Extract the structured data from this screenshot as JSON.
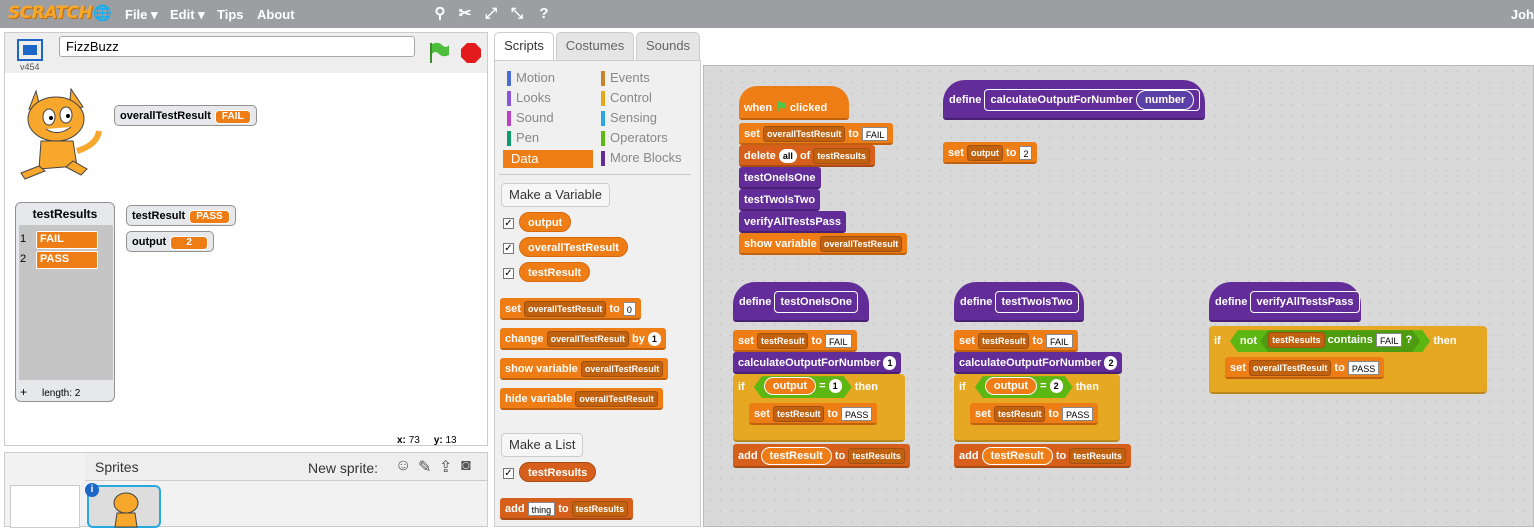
{
  "topbar": {
    "logo": "SCRATCH",
    "menu": [
      "File ▾",
      "Edit ▾",
      "Tips",
      "About"
    ],
    "user": "Joh"
  },
  "stage": {
    "project_name": "FizzBuzz",
    "version": "v454",
    "monitors": {
      "overall_label": "overallTestResult",
      "overall_value": "FAIL",
      "testresult_label": "testResult",
      "testresult_value": "PASS",
      "output_label": "output",
      "output_value": "2"
    },
    "list": {
      "title": "testResults",
      "items": [
        {
          "idx": "1",
          "val": "FAIL"
        },
        {
          "idx": "2",
          "val": "PASS"
        }
      ],
      "add": "+",
      "length": "length: 2"
    },
    "coords": {
      "x_label": "x:",
      "x": "73",
      "y_label": "y:",
      "y": "13"
    }
  },
  "sprites": {
    "title": "Sprites",
    "new_sprite": "New sprite:"
  },
  "tabs": [
    "Scripts",
    "Costumes",
    "Sounds"
  ],
  "palette": {
    "categories": [
      {
        "name": "Motion",
        "color": "#4a6cd4"
      },
      {
        "name": "Events",
        "color": "#c88330"
      },
      {
        "name": "Looks",
        "color": "#8a55d7"
      },
      {
        "name": "Control",
        "color": "#e1a91a"
      },
      {
        "name": "Sound",
        "color": "#bb42c3"
      },
      {
        "name": "Sensing",
        "color": "#2ca5e2"
      },
      {
        "name": "Pen",
        "color": "#0e9a6c"
      },
      {
        "name": "Operators",
        "color": "#5cb712"
      },
      {
        "name": "Data",
        "color": "#ee7d16"
      },
      {
        "name": "More Blocks",
        "color": "#632d99"
      }
    ],
    "make_variable": "Make a Variable",
    "variables": [
      "output",
      "overallTestResult",
      "testResult"
    ],
    "set": "set",
    "change": "change",
    "by": "by",
    "to": "to",
    "show_variable": "show variable",
    "hide_variable": "hide variable",
    "var_dd": "overallTestResult",
    "zero": "0",
    "one": "1",
    "make_list": "Make a List",
    "list_name": "testResults",
    "add": "add",
    "thing": "thing"
  },
  "scripts": {
    "when": "when",
    "clicked": "clicked",
    "set": "set",
    "to": "to",
    "fail": "FAIL",
    "pass": "PASS",
    "delete": "delete",
    "all": "all",
    "of": "of",
    "show_variable": "show variable",
    "overall": "overallTestResult",
    "testResults": "testResults",
    "testResult": "testResult",
    "output": "output",
    "testOneIsOne": "testOneIsOne",
    "testTwoIsTwo": "testTwoIsTwo",
    "verifyAllTestsPass": "verifyAllTestsPass",
    "define": "define",
    "calc": "calculateOutputForNumber",
    "number": "number",
    "two": "2",
    "one": "1",
    "if": "if",
    "then": "then",
    "eq": "=",
    "add": "add",
    "not": "not",
    "contains": "contains",
    "q": "?"
  }
}
